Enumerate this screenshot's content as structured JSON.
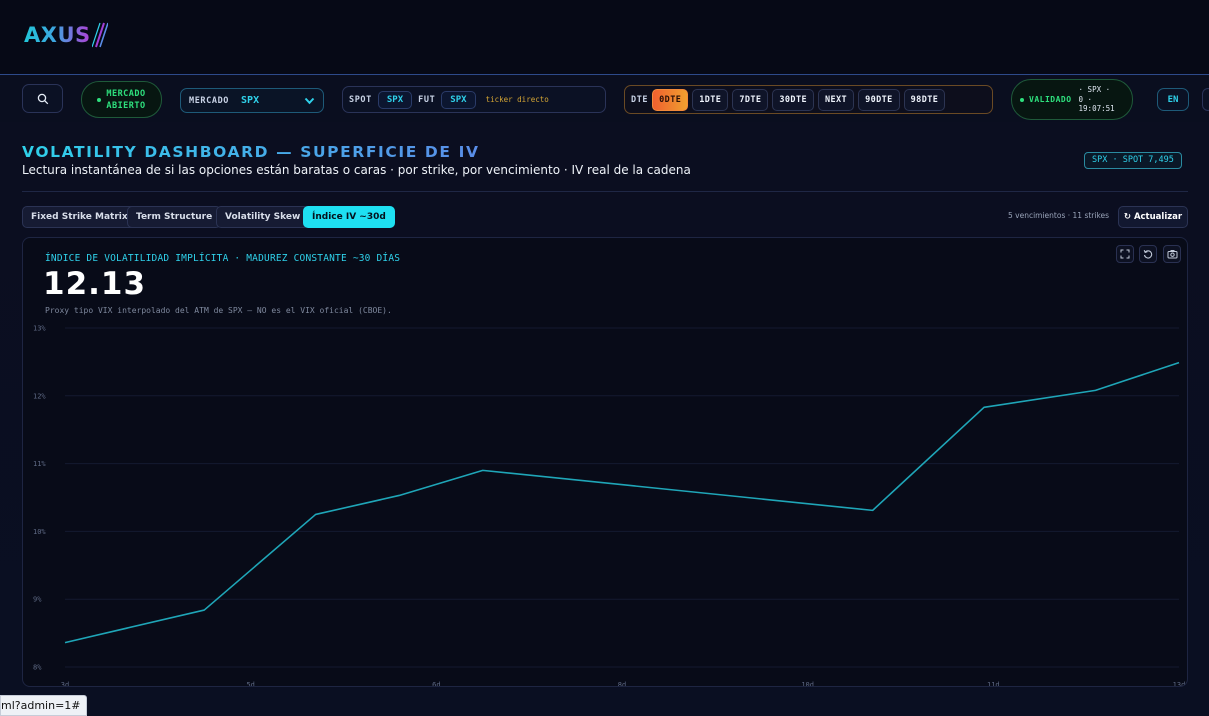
{
  "brand": {
    "logo_text": "AXUS"
  },
  "toolbar": {
    "market_status": "MERCADO\nABIERTO",
    "market_label": "MERCADO",
    "market_value": "SPX",
    "spot_label": "SPOT",
    "spot_value": "SPX",
    "fut_label": "FUT",
    "fut_value": "SPX",
    "ticker_hint": "ticker directo",
    "dte_label": "DTE",
    "dte_options": [
      "0DTE",
      "1DTE",
      "7DTE",
      "30DTE",
      "NEXT",
      "90DTE",
      "98DTE"
    ],
    "dte_selected": "0DTE",
    "validated_label": "VALIDADO",
    "validated_meta": "· SPX ·\n0 ·\n19:07:51",
    "language": "EN"
  },
  "page": {
    "title": "VOLATILITY DASHBOARD — SUPERFICIE DE IV",
    "subtitle": "Lectura instantánea de si las opciones están baratas o caras · por strike, por vencimiento · IV real de la cadena",
    "spot_badge": "SPX · SPOT 7,495"
  },
  "tabs": [
    {
      "label": "Fixed Strike Matrix",
      "active": false
    },
    {
      "label": "Term Structure",
      "active": false
    },
    {
      "label": "Volatility Skew",
      "active": false
    },
    {
      "label": "Índice IV ~30d",
      "active": true
    }
  ],
  "meta": {
    "summary": "5 vencimientos · 11 strikes",
    "refresh_label": "↻ Actualizar"
  },
  "panel": {
    "title": "ÍNDICE DE VOLATILIDAD IMPLÍCITA · MADUREZ CONSTANTE ~30 DÍAS",
    "value": "12.13",
    "note": "Proxy tipo VIX interpolado del ATM de SPX — NO es el VIX oficial (CBOE)."
  },
  "status_url": "ml?admin=1#",
  "colors": {
    "accent": "#2fd1ea",
    "line": "#1fa6b8",
    "positive": "#2ee07d",
    "dte_active": "#f0802f"
  },
  "chart_data": {
    "type": "line",
    "title": "ÍNDICE DE VOLATILIDAD IMPLÍCITA · MADUREZ CONSTANTE ~30 DÍAS",
    "xlabel": "",
    "ylabel": "",
    "y_ticks": [
      "8%",
      "9%",
      "10%",
      "11%",
      "12%",
      "13%"
    ],
    "ylim": [
      8,
      13
    ],
    "x_ticks": [
      "3d",
      "5d",
      "6d",
      "8d",
      "10d",
      "11d",
      "13d"
    ],
    "xlim": [
      3,
      13
    ],
    "grid": true,
    "series": [
      {
        "x": [
          3,
          4.25,
          5.25,
          6.0,
          6.75,
          10.25,
          11.25,
          12.25,
          13
        ],
        "values": [
          8.36,
          8.84,
          10.25,
          10.53,
          10.9,
          10.31,
          11.83,
          12.08,
          12.49
        ]
      }
    ]
  }
}
